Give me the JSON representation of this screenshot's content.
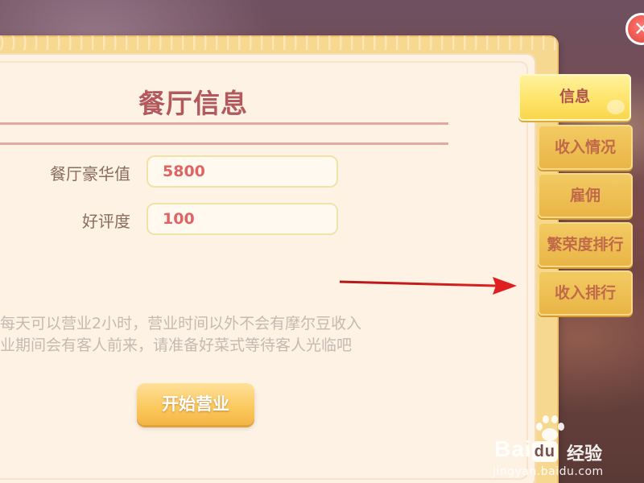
{
  "panel": {
    "title": "餐厅信息"
  },
  "fields": [
    {
      "label": "餐厅豪华值",
      "value": "5800"
    },
    {
      "label": "好评度",
      "value": "100"
    }
  ],
  "description": {
    "line1": "每天可以营业2小时，营业时间以外不会有摩尔豆收入",
    "line2": "业期间会有客人前来，请准备好菜式等待客人光临吧"
  },
  "start_button": {
    "label": "开始营业"
  },
  "tabs": [
    {
      "label": "信息",
      "active": true
    },
    {
      "label": "收入情况",
      "active": false
    },
    {
      "label": "雇佣",
      "active": false
    },
    {
      "label": "繁荣度排行",
      "active": false
    },
    {
      "label": "收入排行",
      "active": false
    }
  ],
  "close_button": {
    "icon": "close-icon",
    "glyph": "✕"
  },
  "annotation": {
    "icon": "red-arrow-icon",
    "color": "#e02020"
  },
  "watermark": {
    "logo_prefix": "Bai",
    "logo_box": "du",
    "logo_cn": "经验",
    "url": "jingyan.baidu.com"
  },
  "colors": {
    "title": "#b4585a",
    "field_value": "#e06464",
    "tab_active": "#ffe46a",
    "tab": "#eebe52",
    "button": "#fbc85c"
  }
}
